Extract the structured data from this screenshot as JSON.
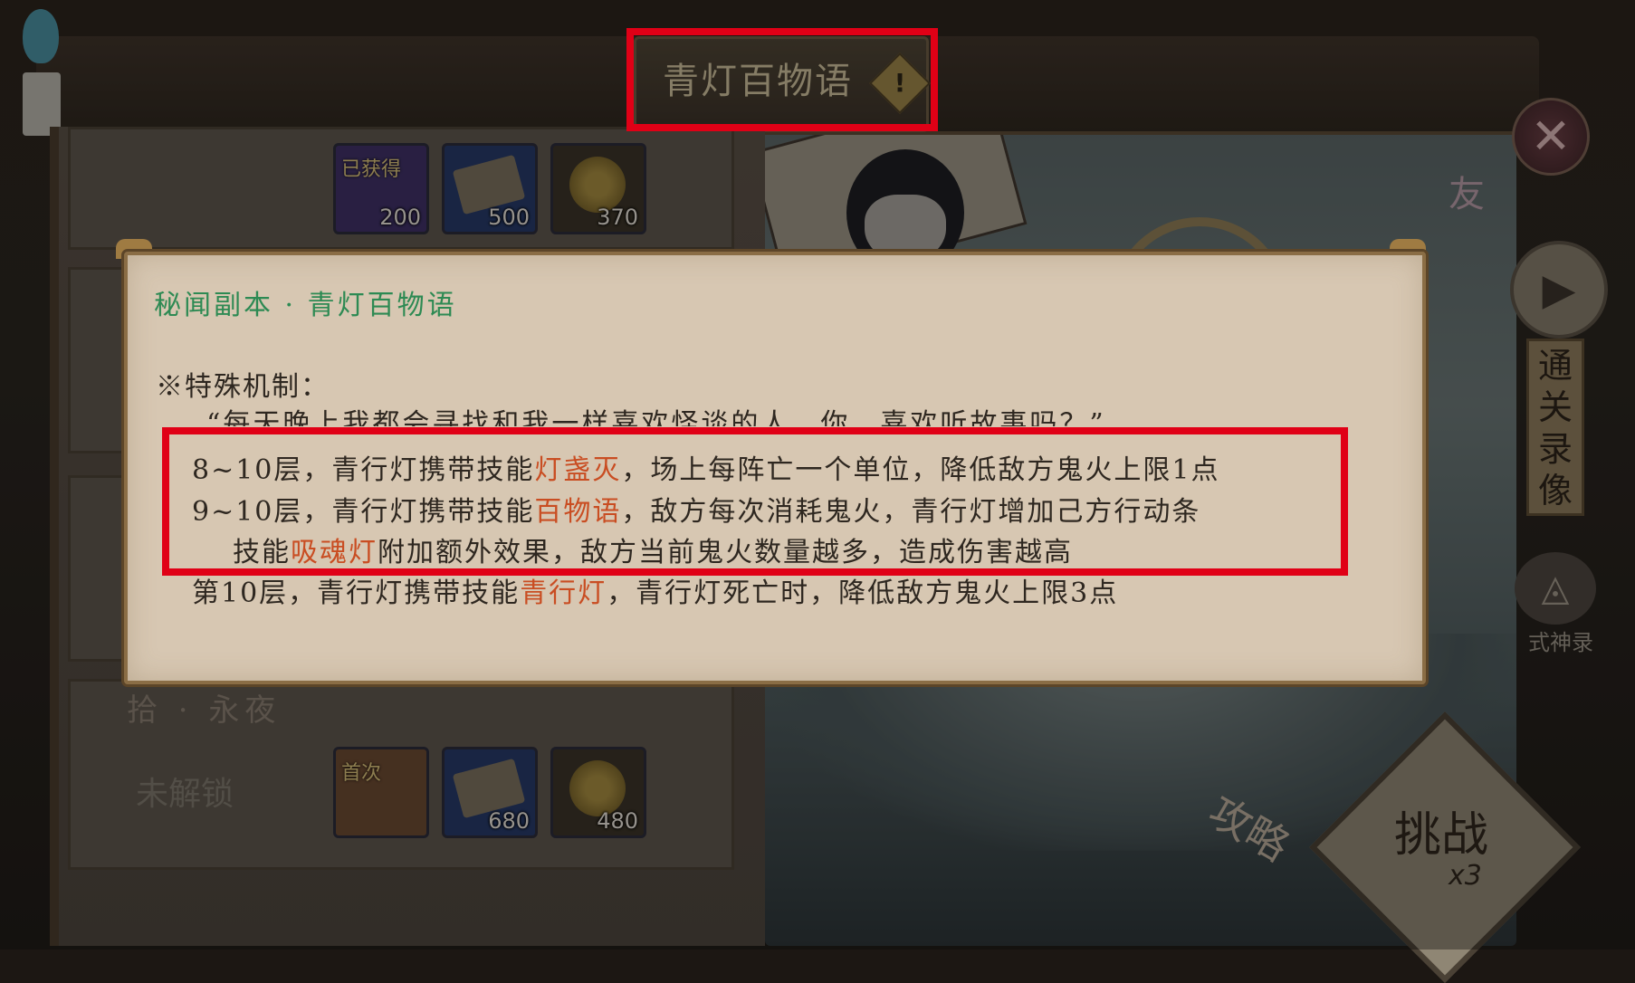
{
  "header": {
    "title": "青灯百物语",
    "warning_icon": "!"
  },
  "rewards_top": [
    {
      "tag": "已获得",
      "count": "200",
      "kind": "portrait-purple"
    },
    {
      "tag": "",
      "count": "500",
      "kind": "exp-scroll"
    },
    {
      "tag": "",
      "count": "370",
      "kind": "gold-coin"
    }
  ],
  "chapter": {
    "name": "拾 · 永夜",
    "status": "未解锁",
    "rewards": [
      {
        "tag": "首次",
        "count": "",
        "kind": "shikigami-portrait"
      },
      {
        "tag": "",
        "count": "680",
        "kind": "exp-scroll"
      },
      {
        "tag": "",
        "count": "480",
        "kind": "gold-coin"
      }
    ]
  },
  "side": {
    "close_icon": "✕",
    "friend_label": "友",
    "play_icon": "▶",
    "replay_label": "通关录像",
    "shikigami_label": "式神录",
    "strategy_label": "攻略",
    "challenge_label": "挑战",
    "challenge_cost": "x3"
  },
  "dialog": {
    "title": "秘闻副本 · 青灯百物语",
    "mechanic_heading": "※特殊机制：",
    "quote": "“每天晚上我都会寻找和我一样喜欢怪谈的人，你，喜欢听故事吗？”",
    "lines": [
      {
        "pre": "8~10层，青行灯携带技能",
        "skill": "灯盏灭",
        "post": "，场上每阵亡一个单位，降低敌方鬼火上限1点"
      },
      {
        "pre": "9~10层，青行灯携带技能",
        "skill": "百物语",
        "post": "，敌方每次消耗鬼火，青行灯增加己方行动条"
      },
      {
        "pre": "技能",
        "skill": "吸魂灯",
        "post": "附加额外效果，敌方当前鬼火数量越多，造成伤害越高"
      },
      {
        "pre": "第10层，青行灯携带技能",
        "skill": "青行灯",
        "post": "，青行灯死亡时，降低敌方鬼火上限3点"
      }
    ]
  },
  "colors": {
    "annotation_red": "#e00016",
    "dialog_title_green": "#2d8a53",
    "skill_orange": "#c94d22"
  }
}
